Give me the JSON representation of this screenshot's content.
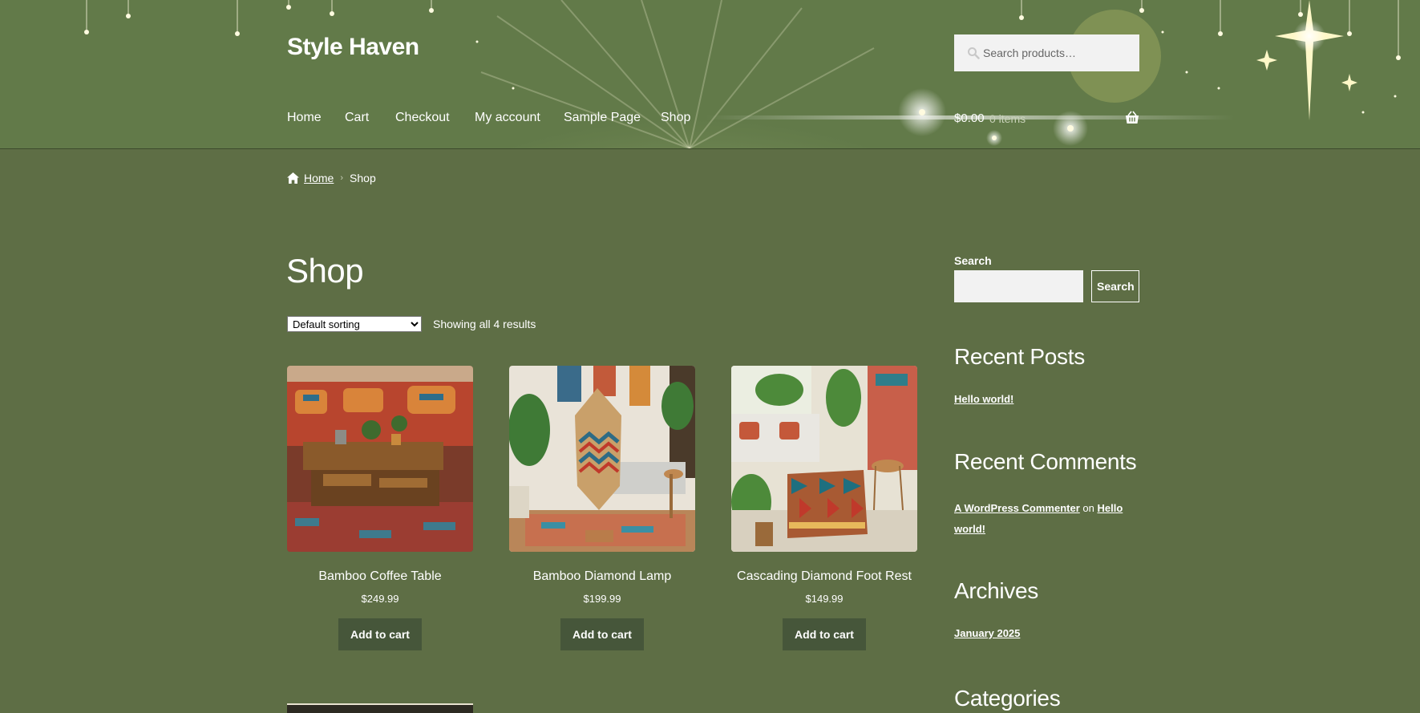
{
  "site": {
    "title": "Style Haven"
  },
  "header": {
    "search_placeholder": "Search products…",
    "nav": [
      "Home",
      "Cart",
      "Checkout",
      "My account",
      "Sample Page",
      "Shop"
    ],
    "cart": {
      "amount": "$0.00",
      "items": "0 items"
    }
  },
  "breadcrumb": {
    "home": "Home",
    "current": "Shop"
  },
  "main": {
    "title": "Shop",
    "sorting": {
      "selected": "Default sorting"
    },
    "result_count": "Showing all 4 results",
    "products": [
      {
        "name": "Bamboo Coffee Table",
        "price": "$249.99",
        "button": "Add to cart"
      },
      {
        "name": "Bamboo Diamond Lamp",
        "price": "$199.99",
        "button": "Add to cart"
      },
      {
        "name": "Cascading Diamond Foot Rest",
        "price": "$149.99",
        "button": "Add to cart"
      }
    ]
  },
  "sidebar": {
    "search": {
      "label": "Search",
      "button": "Search"
    },
    "recent_posts": {
      "heading": "Recent Posts",
      "items": [
        "Hello world!"
      ]
    },
    "recent_comments": {
      "heading": "Recent Comments",
      "author": "A WordPress Commenter",
      "connector": "on",
      "post": "Hello world!"
    },
    "archives": {
      "heading": "Archives",
      "items": [
        "January 2025"
      ]
    },
    "categories": {
      "heading": "Categories"
    }
  },
  "colors": {
    "background": "#5e6e45",
    "header": "#627a49",
    "button": "#46563a",
    "text": "#ffffff"
  }
}
